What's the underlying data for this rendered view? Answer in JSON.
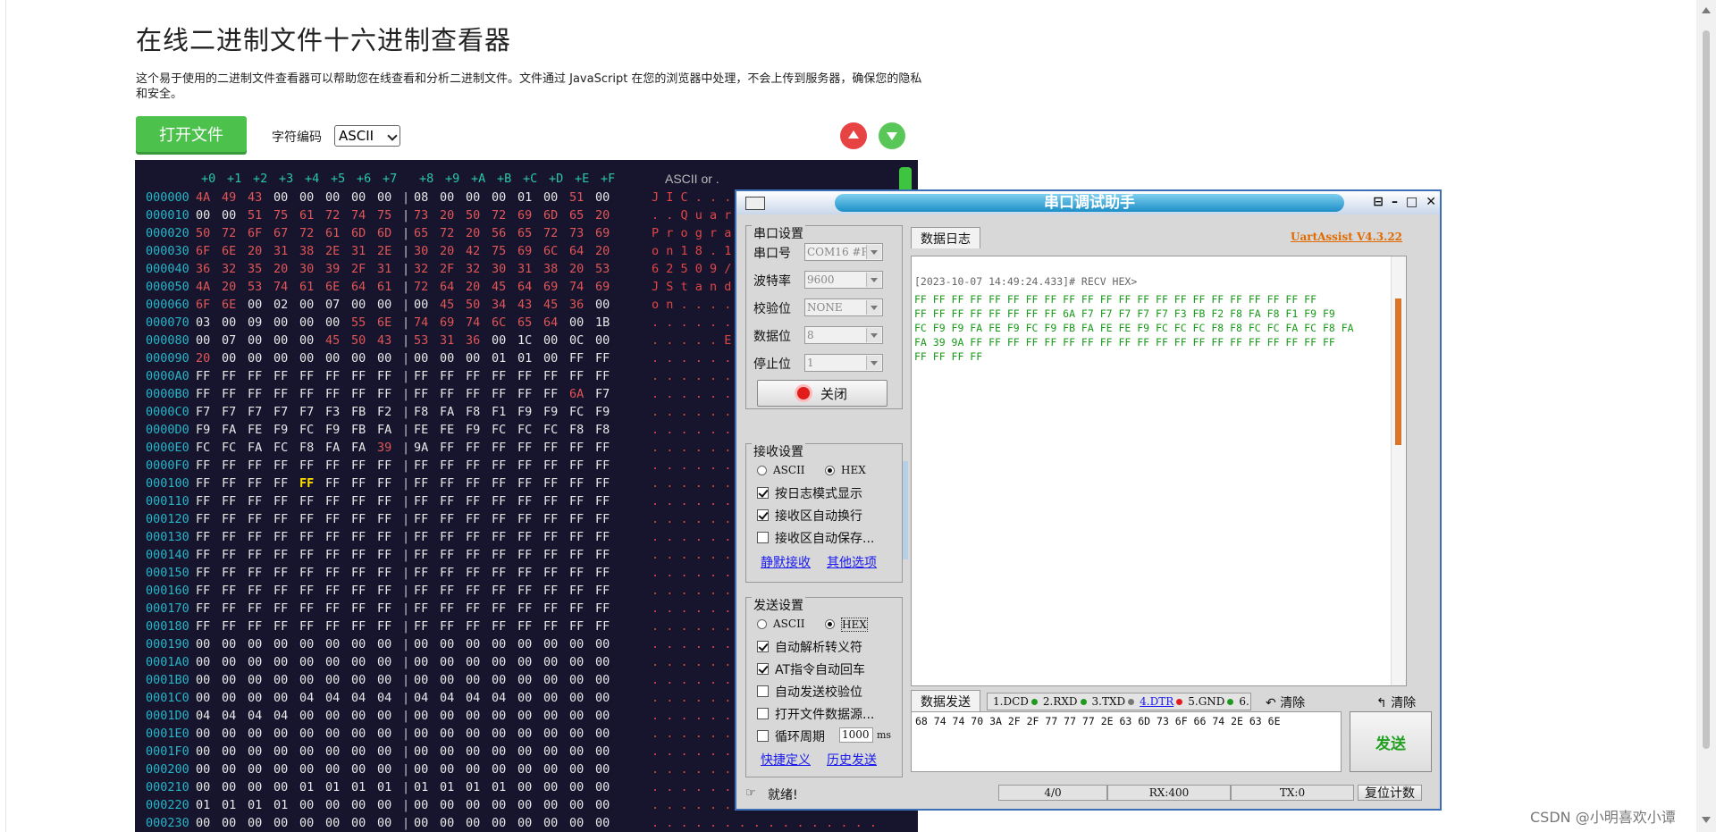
{
  "page": {
    "title": "在线二进制文件十六进制查看器",
    "description": "这个易于使用的二进制文件查看器可以帮助您在线查看和分析二进制文件。文件通过 JavaScript 在您的浏览器中处理，不会上传到服务器，确保您的隐私和安全。",
    "open_button": "打开文件",
    "encoding_label": "字符编码",
    "encoding_value": "ASCII",
    "watermark": "CSDN @小明喜欢小谭"
  },
  "hex": {
    "header_cols": [
      "+0",
      "+1",
      "+2",
      "+3",
      "+4",
      "+5",
      "+6",
      "+7",
      "+8",
      "+9",
      "+A",
      "+B",
      "+C",
      "+D",
      "+E",
      "+F"
    ],
    "ascii_header": "ASCII or .",
    "rows": [
      {
        "addr": "000000",
        "b": [
          "4A",
          "49",
          "43",
          "00",
          "00",
          "00",
          "00",
          "00",
          "08",
          "00",
          "00",
          "00",
          "01",
          "00",
          "51",
          "00"
        ],
        "a": "J I C . . . . . . . . . . . Q ."
      },
      {
        "addr": "000010",
        "b": [
          "00",
          "00",
          "51",
          "75",
          "61",
          "72",
          "74",
          "75",
          "73",
          "20",
          "50",
          "72",
          "69",
          "6D",
          "65",
          "20"
        ],
        "a": ". . Q u a r t u s   P r i m e  "
      },
      {
        "addr": "000020",
        "b": [
          "50",
          "72",
          "6F",
          "67",
          "72",
          "61",
          "6D",
          "6D",
          "65",
          "72",
          "20",
          "56",
          "65",
          "72",
          "73",
          "69"
        ],
        "a": "P r o g r a m m e r   V e r s i"
      },
      {
        "addr": "000030",
        "b": [
          "6F",
          "6E",
          "20",
          "31",
          "38",
          "2E",
          "31",
          "2E",
          "30",
          "20",
          "42",
          "75",
          "69",
          "6C",
          "64",
          "20"
        ],
        "a": "o n   1 8 . 1 . 0   B u i l d  "
      },
      {
        "addr": "000040",
        "b": [
          "36",
          "32",
          "35",
          "20",
          "30",
          "39",
          "2F",
          "31",
          "32",
          "2F",
          "32",
          "30",
          "31",
          "38",
          "20",
          "53"
        ],
        "a": "6 2 5   0 9 / 1 2 / 2 0 1 8   S"
      },
      {
        "addr": "000050",
        "b": [
          "4A",
          "20",
          "53",
          "74",
          "61",
          "6E",
          "64",
          "61",
          "72",
          "64",
          "20",
          "45",
          "64",
          "69",
          "74",
          "69"
        ],
        "a": "J   S t a n d a r d   E d i t i"
      },
      {
        "addr": "000060",
        "b": [
          "6F",
          "6E",
          "00",
          "02",
          "00",
          "07",
          "00",
          "00",
          "00",
          "45",
          "50",
          "34",
          "43",
          "45",
          "36",
          "00"
        ],
        "a": "o n . . . . . . . E P 4 C E 6 ."
      },
      {
        "addr": "000070",
        "b": [
          "03",
          "00",
          "09",
          "00",
          "00",
          "00",
          "55",
          "6E",
          "74",
          "69",
          "74",
          "6C",
          "65",
          "64",
          "00",
          "1B"
        ],
        "a": ". . . . . . U n t i t l e d . ."
      },
      {
        "addr": "000080",
        "b": [
          "00",
          "07",
          "00",
          "00",
          "00",
          "45",
          "50",
          "43",
          "53",
          "31",
          "36",
          "00",
          "1C",
          "00",
          "0C",
          "00"
        ],
        "a": ". . . . . E P C S 1 6 . . . . ."
      },
      {
        "addr": "000090",
        "b": [
          "20",
          "00",
          "00",
          "00",
          "00",
          "00",
          "00",
          "00",
          "00",
          "00",
          "00",
          "01",
          "01",
          "00",
          "FF",
          "FF"
        ],
        "a": "  . . . . . . . . . . . . . . ."
      },
      {
        "addr": "0000A0",
        "b": [
          "FF",
          "FF",
          "FF",
          "FF",
          "FF",
          "FF",
          "FF",
          "FF",
          "FF",
          "FF",
          "FF",
          "FF",
          "FF",
          "FF",
          "FF",
          "FF"
        ],
        "a": ". . . . . . . . . . . . . . . ."
      },
      {
        "addr": "0000B0",
        "b": [
          "FF",
          "FF",
          "FF",
          "FF",
          "FF",
          "FF",
          "FF",
          "FF",
          "FF",
          "FF",
          "FF",
          "FF",
          "FF",
          "FF",
          "6A",
          "F7"
        ],
        "a": ". . . . . . . . . . . . . . j ."
      },
      {
        "addr": "0000C0",
        "b": [
          "F7",
          "F7",
          "F7",
          "F7",
          "F7",
          "F3",
          "FB",
          "F2",
          "F8",
          "FA",
          "F8",
          "F1",
          "F9",
          "F9",
          "FC",
          "F9"
        ],
        "a": ". . . . . . . . . . . . . . . ."
      },
      {
        "addr": "0000D0",
        "b": [
          "F9",
          "FA",
          "FE",
          "F9",
          "FC",
          "F9",
          "FB",
          "FA",
          "FE",
          "FE",
          "F9",
          "FC",
          "FC",
          "FC",
          "F8",
          "F8"
        ],
        "a": ". . . . . . . . . . . . . . . ."
      },
      {
        "addr": "0000E0",
        "b": [
          "FC",
          "FC",
          "FA",
          "FC",
          "F8",
          "FA",
          "FA",
          "39",
          "9A",
          "FF",
          "FF",
          "FF",
          "FF",
          "FF",
          "FF",
          "FF"
        ],
        "a": ". . . . . . . 9 . . . . . . . ."
      },
      {
        "addr": "0000F0",
        "b": [
          "FF",
          "FF",
          "FF",
          "FF",
          "FF",
          "FF",
          "FF",
          "FF",
          "FF",
          "FF",
          "FF",
          "FF",
          "FF",
          "FF",
          "FF",
          "FF"
        ],
        "a": ". . . . . . . . . . . . . . . ."
      },
      {
        "addr": "000100",
        "b": [
          "FF",
          "FF",
          "FF",
          "FF",
          "FF",
          "FF",
          "FF",
          "FF",
          "FF",
          "FF",
          "FF",
          "FF",
          "FF",
          "FF",
          "FF",
          "FF"
        ],
        "a": ". . . . . . . . . . . . . . . ."
      },
      {
        "addr": "000110",
        "b": [
          "FF",
          "FF",
          "FF",
          "FF",
          "FF",
          "FF",
          "FF",
          "FF",
          "FF",
          "FF",
          "FF",
          "FF",
          "FF",
          "FF",
          "FF",
          "FF"
        ],
        "a": ". . . . . . . . . . . . . . . ."
      },
      {
        "addr": "000120",
        "b": [
          "FF",
          "FF",
          "FF",
          "FF",
          "FF",
          "FF",
          "FF",
          "FF",
          "FF",
          "FF",
          "FF",
          "FF",
          "FF",
          "FF",
          "FF",
          "FF"
        ],
        "a": ". . . . . . . . . . . . . . . ."
      },
      {
        "addr": "000130",
        "b": [
          "FF",
          "FF",
          "FF",
          "FF",
          "FF",
          "FF",
          "FF",
          "FF",
          "FF",
          "FF",
          "FF",
          "FF",
          "FF",
          "FF",
          "FF",
          "FF"
        ],
        "a": ". . . . . . . . . . . . . . . ."
      },
      {
        "addr": "000140",
        "b": [
          "FF",
          "FF",
          "FF",
          "FF",
          "FF",
          "FF",
          "FF",
          "FF",
          "FF",
          "FF",
          "FF",
          "FF",
          "FF",
          "FF",
          "FF",
          "FF"
        ],
        "a": ". . . . . . . . . . . . . . . ."
      },
      {
        "addr": "000150",
        "b": [
          "FF",
          "FF",
          "FF",
          "FF",
          "FF",
          "FF",
          "FF",
          "FF",
          "FF",
          "FF",
          "FF",
          "FF",
          "FF",
          "FF",
          "FF",
          "FF"
        ],
        "a": ". . . . . . . . . . . . . . . ."
      },
      {
        "addr": "000160",
        "b": [
          "FF",
          "FF",
          "FF",
          "FF",
          "FF",
          "FF",
          "FF",
          "FF",
          "FF",
          "FF",
          "FF",
          "FF",
          "FF",
          "FF",
          "FF",
          "FF"
        ],
        "a": ". . . . . . . . . . . . . . . ."
      },
      {
        "addr": "000170",
        "b": [
          "FF",
          "FF",
          "FF",
          "FF",
          "FF",
          "FF",
          "FF",
          "FF",
          "FF",
          "FF",
          "FF",
          "FF",
          "FF",
          "FF",
          "FF",
          "FF"
        ],
        "a": ". . . . . . . . . . . . . . . ."
      },
      {
        "addr": "000180",
        "b": [
          "FF",
          "FF",
          "FF",
          "FF",
          "FF",
          "FF",
          "FF",
          "FF",
          "FF",
          "FF",
          "FF",
          "FF",
          "FF",
          "FF",
          "FF",
          "FF"
        ],
        "a": ". . . . . . . . . . . . . . . ."
      },
      {
        "addr": "000190",
        "b": [
          "00",
          "00",
          "00",
          "00",
          "00",
          "00",
          "00",
          "00",
          "00",
          "00",
          "00",
          "00",
          "00",
          "00",
          "00",
          "00"
        ],
        "a": ". . . . . . . . . . . . . . . ."
      },
      {
        "addr": "0001A0",
        "b": [
          "00",
          "00",
          "00",
          "00",
          "00",
          "00",
          "00",
          "00",
          "00",
          "00",
          "00",
          "00",
          "00",
          "00",
          "00",
          "00"
        ],
        "a": ". . . . . . . . . . . . . . . ."
      },
      {
        "addr": "0001B0",
        "b": [
          "00",
          "00",
          "00",
          "00",
          "00",
          "00",
          "00",
          "00",
          "00",
          "00",
          "00",
          "00",
          "00",
          "00",
          "00",
          "00"
        ],
        "a": ". . . . . . . . . . . . . . . ."
      },
      {
        "addr": "0001C0",
        "b": [
          "00",
          "00",
          "00",
          "00",
          "04",
          "04",
          "04",
          "04",
          "04",
          "04",
          "04",
          "04",
          "00",
          "00",
          "00",
          "00"
        ],
        "a": ". . . . . . . . . . . . . . . ."
      },
      {
        "addr": "0001D0",
        "b": [
          "04",
          "04",
          "04",
          "04",
          "00",
          "00",
          "00",
          "00",
          "00",
          "00",
          "00",
          "00",
          "00",
          "00",
          "00",
          "00"
        ],
        "a": ". . . . . . . . . . . . . . . ."
      },
      {
        "addr": "0001E0",
        "b": [
          "00",
          "00",
          "00",
          "00",
          "00",
          "00",
          "00",
          "00",
          "00",
          "00",
          "00",
          "00",
          "00",
          "00",
          "00",
          "00"
        ],
        "a": ". . . . . . . . . . . . . . . ."
      },
      {
        "addr": "0001F0",
        "b": [
          "00",
          "00",
          "00",
          "00",
          "00",
          "00",
          "00",
          "00",
          "00",
          "00",
          "00",
          "00",
          "00",
          "00",
          "00",
          "00"
        ],
        "a": ". . . . . . . . . . . . . . . ."
      },
      {
        "addr": "000200",
        "b": [
          "00",
          "00",
          "00",
          "00",
          "00",
          "00",
          "00",
          "00",
          "00",
          "00",
          "00",
          "00",
          "00",
          "00",
          "00",
          "00"
        ],
        "a": ". . . . . . . . . . . . . . . ."
      },
      {
        "addr": "000210",
        "b": [
          "00",
          "00",
          "00",
          "00",
          "01",
          "01",
          "01",
          "01",
          "01",
          "01",
          "01",
          "01",
          "00",
          "00",
          "00",
          "00"
        ],
        "a": ". . . . . . . . . . . . . . . ."
      },
      {
        "addr": "000220",
        "b": [
          "01",
          "01",
          "01",
          "01",
          "00",
          "00",
          "00",
          "00",
          "00",
          "00",
          "00",
          "00",
          "00",
          "00",
          "00",
          "00"
        ],
        "a": ". . . . . . . . . . . . . . . ."
      },
      {
        "addr": "000230",
        "b": [
          "00",
          "00",
          "00",
          "00",
          "00",
          "00",
          "00",
          "00",
          "00",
          "00",
          "00",
          "00",
          "00",
          "00",
          "00",
          "00"
        ],
        "a": ". . . . . . . . . . . . . . . ."
      }
    ],
    "highlight": {
      "row": 16,
      "col": 4
    }
  },
  "serial": {
    "title": "串口调试助手",
    "port_group": "串口设置",
    "port_label": "串口号",
    "port_value": "COM16 #P",
    "baud_label": "波特率",
    "baud_value": "9600",
    "parity_label": "校验位",
    "parity_value": "NONE",
    "databits_label": "数据位",
    "databits_value": "8",
    "stopbits_label": "停止位",
    "stopbits_value": "1",
    "close_button": "关闭",
    "recv_group": "接收设置",
    "recv_ascii": "ASCII",
    "recv_hex": "HEX",
    "recv_opt1": "按日志模式显示",
    "recv_opt2": "接收区自动换行",
    "recv_opt3": "接收区自动保存...",
    "recv_link1": "静默接收",
    "recv_link2": "其他选项",
    "send_group": "发送设置",
    "send_ascii": "ASCII",
    "send_hex": "HEX",
    "send_opt1": "自动解析转义符",
    "send_opt2": "AT指令自动回车",
    "send_opt3": "自动发送校验位",
    "send_opt4": "打开文件数据源...",
    "send_opt5": "循环周期",
    "cycle_value": "1000",
    "cycle_unit": "ms",
    "send_link1": "快捷定义",
    "send_link2": "历史发送",
    "log_tab": "数据日志",
    "version": "UartAssist V4.3.22",
    "recv_header": "[2023-10-07 14:49:24.433]# RECV HEX>",
    "recv_lines": [
      "FF FF FF FF FF FF FF FF FF FF FF FF FF FF FF FF FF FF FF FF FF FF",
      "FF FF FF FF FF FF FF FF 6A F7 F7 F7 F7 F7 F3 FB F2 F8 FA F8 F1 F9 F9",
      "FC F9 F9 FA FE F9 FC F9 FB FA FE FE F9 FC FC FC F8 F8 FC FC FA FC F8 FA",
      "FA 39 9A FF FF FF FF FF FF FF FF FF FF FF FF FF FF FF FF FF FF FF FF",
      "FF FF FF FF"
    ],
    "send_tab": "数据发送",
    "pins": [
      "1.DCD",
      "2.RXD",
      "3.TXD",
      "4.DTR",
      "5.GND",
      "6."
    ],
    "clear1": "清除",
    "clear2": "清除",
    "send_text": "68 74 74 70 3A 2F 2F 77 77 77 2E 63 6D 73 6F 66 74 2E 63 6E",
    "send_button": "发送",
    "status_ready": "就绪!",
    "status_count": "4/0",
    "status_rx": "RX:400",
    "status_tx": "TX:0",
    "reset_button": "复位计数",
    "colors": {
      "title": "#1d8ec7",
      "recv_text": "#1a9a1a",
      "version": "#e06a00"
    }
  }
}
